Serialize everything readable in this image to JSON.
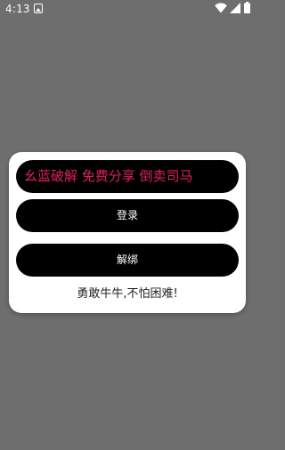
{
  "status_bar": {
    "time": "4:13",
    "icons": [
      "app-notification-icon",
      "wifi-icon",
      "signal-icon",
      "battery-icon"
    ]
  },
  "dialog": {
    "title_text": "幺蓝破解 免费分享 倒卖司马",
    "title_color": "#e0215f",
    "login_label": "登录",
    "unbind_label": "解绑",
    "motto": "勇敢牛牛,不怕困难!"
  },
  "colors": {
    "backdrop": "#6e6e6e",
    "dialog_background": "#ffffff",
    "button_background": "#000000",
    "button_text": "#ffffff"
  }
}
